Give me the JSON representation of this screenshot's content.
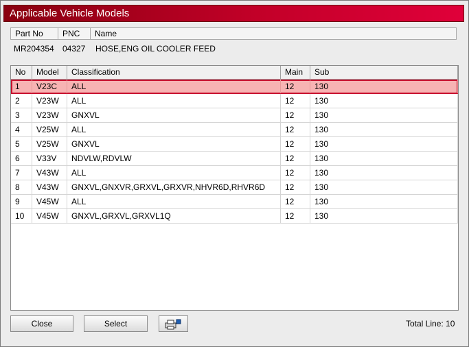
{
  "window": {
    "title": "Applicable Vehicle Models"
  },
  "part": {
    "headers": {
      "part_no": "Part No",
      "pnc": "PNC",
      "name": "Name"
    },
    "values": {
      "part_no": "MR204354",
      "pnc": "04327",
      "name": "HOSE,ENG OIL COOLER FEED"
    }
  },
  "table": {
    "columns": {
      "no": "No",
      "model": "Model",
      "classification": "Classification",
      "main": "Main",
      "sub": "Sub"
    },
    "selected_row": 0,
    "rows": [
      {
        "no": "1",
        "model": "V23C",
        "classification": "ALL",
        "main": "12",
        "sub": "130"
      },
      {
        "no": "2",
        "model": "V23W",
        "classification": "ALL",
        "main": "12",
        "sub": "130"
      },
      {
        "no": "3",
        "model": "V23W",
        "classification": "GNXVL",
        "main": "12",
        "sub": "130"
      },
      {
        "no": "4",
        "model": "V25W",
        "classification": "ALL",
        "main": "12",
        "sub": "130"
      },
      {
        "no": "5",
        "model": "V25W",
        "classification": "GNXVL",
        "main": "12",
        "sub": "130"
      },
      {
        "no": "6",
        "model": "V33V",
        "classification": "NDVLW,RDVLW",
        "main": "12",
        "sub": "130"
      },
      {
        "no": "7",
        "model": "V43W",
        "classification": "ALL",
        "main": "12",
        "sub": "130"
      },
      {
        "no": "8",
        "model": "V43W",
        "classification": "GNXVL,GNXVR,GRXVL,GRXVR,NHVR6D,RHVR6D",
        "main": "12",
        "sub": "130"
      },
      {
        "no": "9",
        "model": "V45W",
        "classification": "ALL",
        "main": "12",
        "sub": "130"
      },
      {
        "no": "10",
        "model": "V45W",
        "classification": "GNXVL,GRXVL,GRXVL1Q",
        "main": "12",
        "sub": "130"
      }
    ]
  },
  "footer": {
    "close_label": "Close",
    "select_label": "Select",
    "print_icon": "printer-icon",
    "total_label": "Total Line: 10"
  },
  "colors": {
    "title_gradient_start": "#8a0010",
    "title_gradient_end": "#e0003a",
    "selection_fill": "#f7b3b3",
    "selection_border": "#c8102e"
  }
}
